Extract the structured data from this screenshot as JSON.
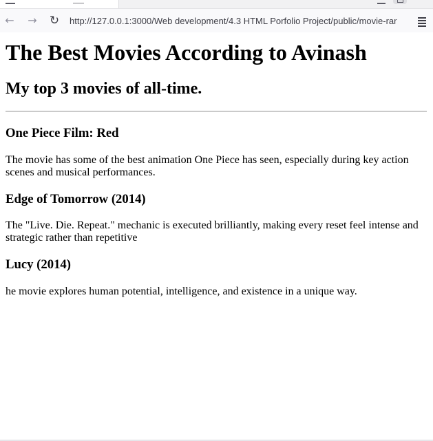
{
  "browser": {
    "url": "http://127.0.0.1:3000/Web development/4.3 HTML Porfolio Project/public/movie-rar",
    "icons": {
      "back": "arrow-left-icon",
      "forward": "arrow-right-icon",
      "reload": "reload-icon",
      "menu": "hamburger-menu-icon"
    }
  },
  "page": {
    "title": "The Best Movies According to Avinash",
    "subtitle": "My top 3 movies of all-time.",
    "movies": [
      {
        "title": "One Piece Film: Red",
        "description": "The movie has some of the best animation One Piece has seen, especially during key action scenes and musical performances."
      },
      {
        "title": "Edge of Tomorrow (2014)",
        "description": "The \"Live. Die. Repeat.\" mechanic is executed brilliantly, making every reset feel intense and strategic rather than repetitive"
      },
      {
        "title": "Lucy (2014)",
        "description": "he movie explores human potential, intelligence, and existence in a unique way."
      }
    ]
  }
}
